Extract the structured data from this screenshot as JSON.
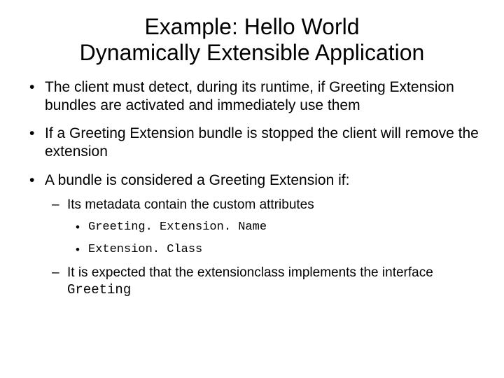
{
  "title_line1": "Example: Hello World",
  "title_line2": "Dynamically Extensible Application",
  "bullets": {
    "b1": "The client must detect, during its runtime, if Greeting Extension bundles are activated and immediately use them",
    "b2": "If a Greeting Extension bundle is stopped the client will remove the extension",
    "b3": "A bundle is considered a Greeting Extension if:",
    "b3_s1": "Its metadata contain the custom attributes",
    "b3_s1_i1": "Greeting. Extension. Name",
    "b3_s1_i2": "Extension. Class",
    "b3_s2_prefix": "It is expected that the extensionclass implements the interface ",
    "b3_s2_mono": "Greeting"
  }
}
